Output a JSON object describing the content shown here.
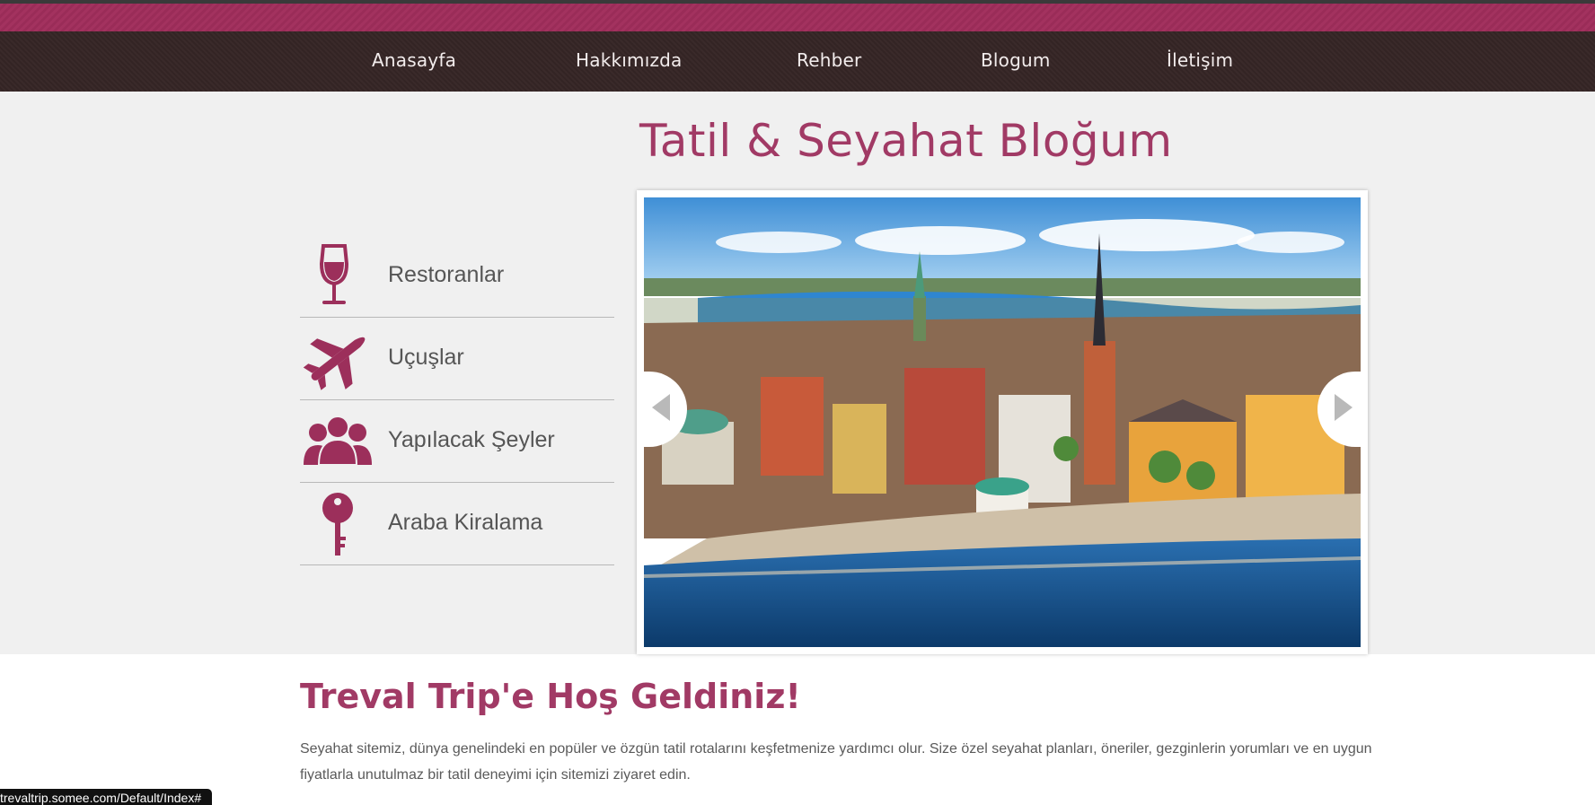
{
  "nav": {
    "items": [
      {
        "label": "Anasayfa"
      },
      {
        "label": "Hakkımızda"
      },
      {
        "label": "Rehber"
      },
      {
        "label": "Blogum"
      },
      {
        "label": "İletişim"
      }
    ]
  },
  "hero": {
    "title": "Tatil & Seyahat Bloğum"
  },
  "categories": [
    {
      "label": "Restoranlar",
      "icon": "wine-glass-icon"
    },
    {
      "label": "Uçuşlar",
      "icon": "airplane-icon"
    },
    {
      "label": "Yapılacak Şeyler",
      "icon": "people-group-icon"
    },
    {
      "label": "Araba Kiralama",
      "icon": "key-icon"
    }
  ],
  "slider": {
    "image": "city-waterfront-photo",
    "prev_icon": "chevron-left-icon",
    "next_icon": "chevron-right-icon"
  },
  "welcome": {
    "title": "Treval Trip'e Hoş Geldiniz!",
    "text": "Seyahat sitemiz, dünya genelindeki en popüler ve özgün tatil rotalarını keşfetmenize yardımcı olur. Size özel seyahat planları, öneriler, gezginlerin yorumları ve en uygun fiyatlarla unutulmaz bir tatil deneyimi için sitemizi ziyaret edin."
  },
  "status_bar": {
    "url": "trevaltrip.somee.com/Default/Index#"
  },
  "colors": {
    "accent": "#a13a65",
    "nav_bg": "#362727",
    "hero_bg": "#f0f0f0"
  }
}
